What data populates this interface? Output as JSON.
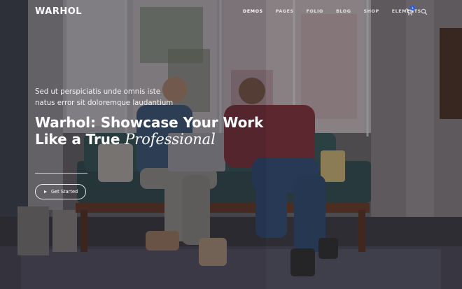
{
  "brand": {
    "logo": "WARHOL"
  },
  "nav": {
    "items": [
      {
        "label": "DEMOS",
        "active": true
      },
      {
        "label": "PAGES",
        "active": false
      },
      {
        "label": "FOLIO",
        "active": false
      },
      {
        "label": "BLOG",
        "active": false
      },
      {
        "label": "SHOP",
        "active": false
      },
      {
        "label": "ELEMENTS",
        "active": false
      }
    ],
    "cart_count": "1",
    "icons": [
      "cart-icon",
      "search-icon"
    ]
  },
  "hero": {
    "subtitle_line1": "Sed ut perspiciatis unde omnis iste",
    "subtitle_line2": "natus error sit doloremque laudantium",
    "headline_line1": "Warhol: Showcase Your Work",
    "headline_line2_start": "Like a True ",
    "headline_line2_italic": "Professional",
    "cta_label": "Get Started"
  },
  "colors": {
    "badge": "#2f5fe0",
    "overlay": "#1e1d22"
  }
}
